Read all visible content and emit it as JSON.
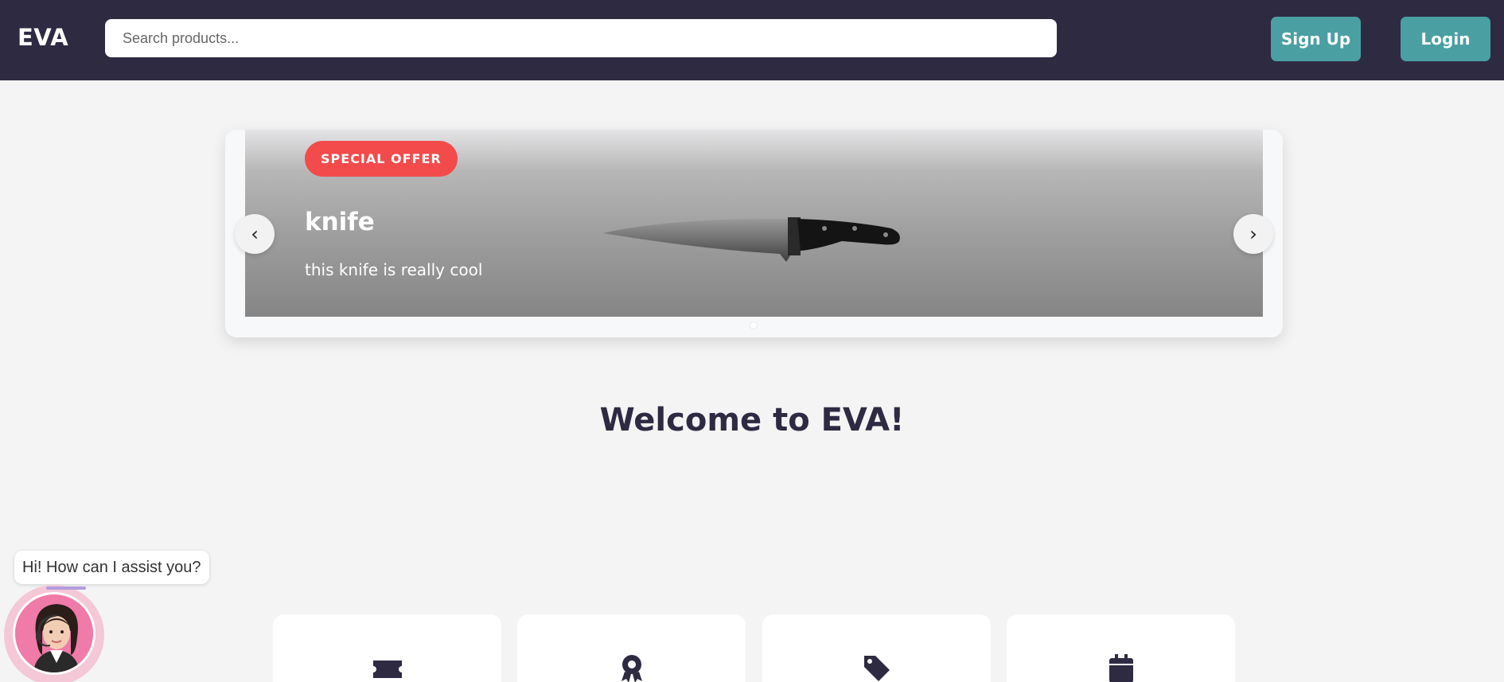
{
  "header": {
    "logo": "EVA",
    "search_placeholder": "Search products...",
    "signup_label": "Sign Up",
    "login_label": "Login"
  },
  "carousel": {
    "badge": "SPECIAL OFFER",
    "title": "knife",
    "description": "this knife is really cool",
    "prev_label": "‹",
    "next_label": "›",
    "image_icon": "knife-image",
    "slide_count": 1
  },
  "welcome": "Welcome to EVA!",
  "cards": [
    {
      "icon": "ticket-icon"
    },
    {
      "icon": "award-icon"
    },
    {
      "icon": "tag-icon"
    },
    {
      "icon": "calendar-icon"
    }
  ],
  "chat": {
    "message": "Hi! How can I assist you?",
    "avatar": "support-agent-avatar"
  },
  "colors": {
    "header_bg": "#2e2a42",
    "accent": "#4a9fa3",
    "badge": "#f34b4b",
    "page_bg": "#f4f4f4"
  }
}
